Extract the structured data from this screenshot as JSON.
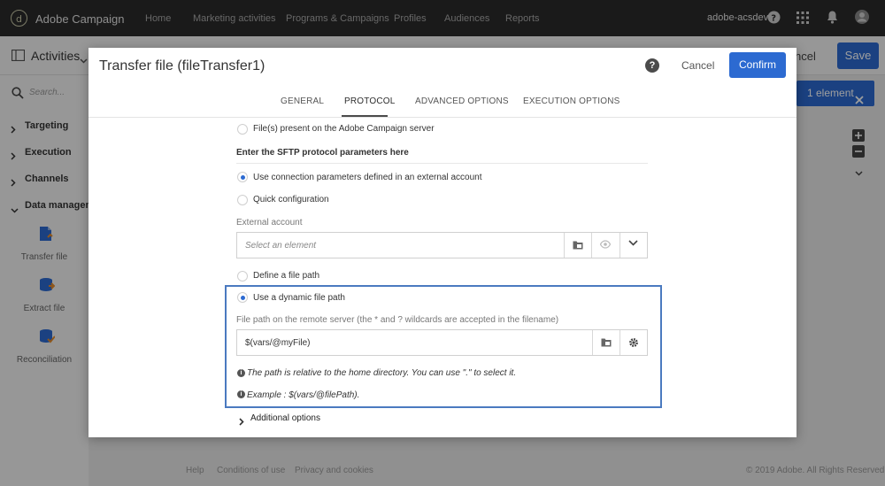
{
  "topnav": {
    "brand": "Adobe Campaign",
    "items": [
      "Home",
      "Marketing activities",
      "Programs & Campaigns",
      "Profiles",
      "Audiences",
      "Reports"
    ],
    "tenant": "adobe-acsdev"
  },
  "header": {
    "title": "Activities",
    "cancel_label": "ncel",
    "save_label": "Save"
  },
  "sidebar": {
    "search_placeholder": "Search...",
    "categories": [
      "Targeting",
      "Execution",
      "Channels",
      "Data manageme"
    ],
    "activities": [
      "Transfer file",
      "Extract file",
      "Reconciliation"
    ]
  },
  "workspace": {
    "selection_chip": "1 element"
  },
  "footer": {
    "links": [
      "Help",
      "Conditions of use",
      "Privacy and cookies"
    ],
    "copyright": "© 2019 Adobe. All Rights Reserved"
  },
  "modal": {
    "title": "Transfer file (fileTransfer1)",
    "cancel_label": "Cancel",
    "confirm_label": "Confirm",
    "tabs": [
      "GENERAL",
      "PROTOCOL",
      "ADVANCED OPTIONS",
      "EXECUTION OPTIONS"
    ],
    "active_tab": "PROTOCOL",
    "options": {
      "files_present": "File(s) present on the Adobe Campaign server",
      "sftp_heading": "Enter the SFTP protocol parameters here",
      "use_connection": "Use connection parameters defined in an external account",
      "quick_config": "Quick configuration",
      "external_account_label": "External account",
      "external_account_placeholder": "Select an element",
      "define_path": "Define a file path",
      "dynamic_path": "Use a dynamic file path",
      "remote_path_label": "File path on the remote server (the * and ? wildcards are accepted in the filename)",
      "remote_path_value": "$(vars/@myFile)",
      "info_relative": "The path is relative to the home directory. You can use \".\" to select it.",
      "info_example": "Example : $(vars/@filePath).",
      "additional_options": "Additional options"
    }
  },
  "colors": {
    "accent": "#2c6ad1",
    "topnav": "#2b2b2b",
    "highlight_border": "#4b7ac0"
  }
}
